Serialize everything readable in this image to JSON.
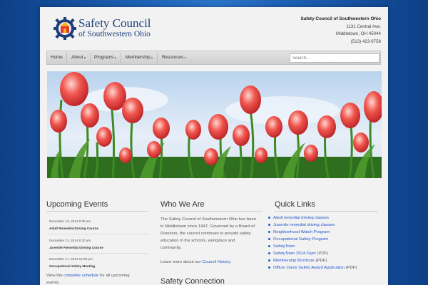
{
  "brand": {
    "line1": "Safety Council",
    "line2": "of Southwestern Ohio"
  },
  "contact": {
    "org": "Safety Council of Southwestern Ohio",
    "street": "1131 Central Ave.",
    "city": "Middletown, OH 45044",
    "phone": "(513) 423-9758"
  },
  "nav": {
    "items": [
      "Home",
      "About",
      "Programs",
      "Membership",
      "Resources"
    ],
    "caret": "▸"
  },
  "search": {
    "placeholder": "Search..."
  },
  "colors": {
    "brand": "#1c3f7a",
    "link": "#2255cc",
    "bgBlue": "#1f63b8"
  },
  "events": {
    "title": "Upcoming Events",
    "items": [
      {
        "date": "December 13, 2014 8:30 am",
        "name": "Adult Remedial Driving Course"
      },
      {
        "date": "December 13, 2014 8:30 am",
        "name": "Juvenile Remedial Driving Course"
      },
      {
        "date": "December 17, 2014 12:00 pm",
        "name": "Occupational Safety Meeting"
      }
    ],
    "footer_pre": "View the ",
    "footer_link": "complete schedule",
    "footer_post": " for all upcoming",
    "footer_cont": "events."
  },
  "about": {
    "title": "Who We Are",
    "lines": [
      "The Safety Council of Southwestern Ohio has been",
      "in Middletown since 1947. Governed by a Board of",
      "Directors, the council continues to provide safety",
      "education in the schools, workplace and",
      "community."
    ],
    "learn_pre": "Learn more about our ",
    "learn_link": "Council History",
    "learn_post": ".",
    "next_title": "Safety Connection"
  },
  "quick": {
    "title": "Quick Links",
    "items": [
      {
        "link": "Adult remedial driving classes",
        "suffix": ""
      },
      {
        "link": "Juvenile remedial driving classes",
        "suffix": ""
      },
      {
        "link": "Neighborhood Watch Program",
        "suffix": ""
      },
      {
        "link": "Occupational Safety Program",
        "suffix": ""
      },
      {
        "link": "SafetyTown",
        "suffix": ""
      },
      {
        "link": "SafetyTown 2014 Flyer",
        "suffix": " (PDF)"
      },
      {
        "link": "Membership Brochure",
        "suffix": " (PDF)"
      },
      {
        "link": "Officer Davis Safety Award Application",
        "suffix": " (PDF)"
      }
    ]
  }
}
